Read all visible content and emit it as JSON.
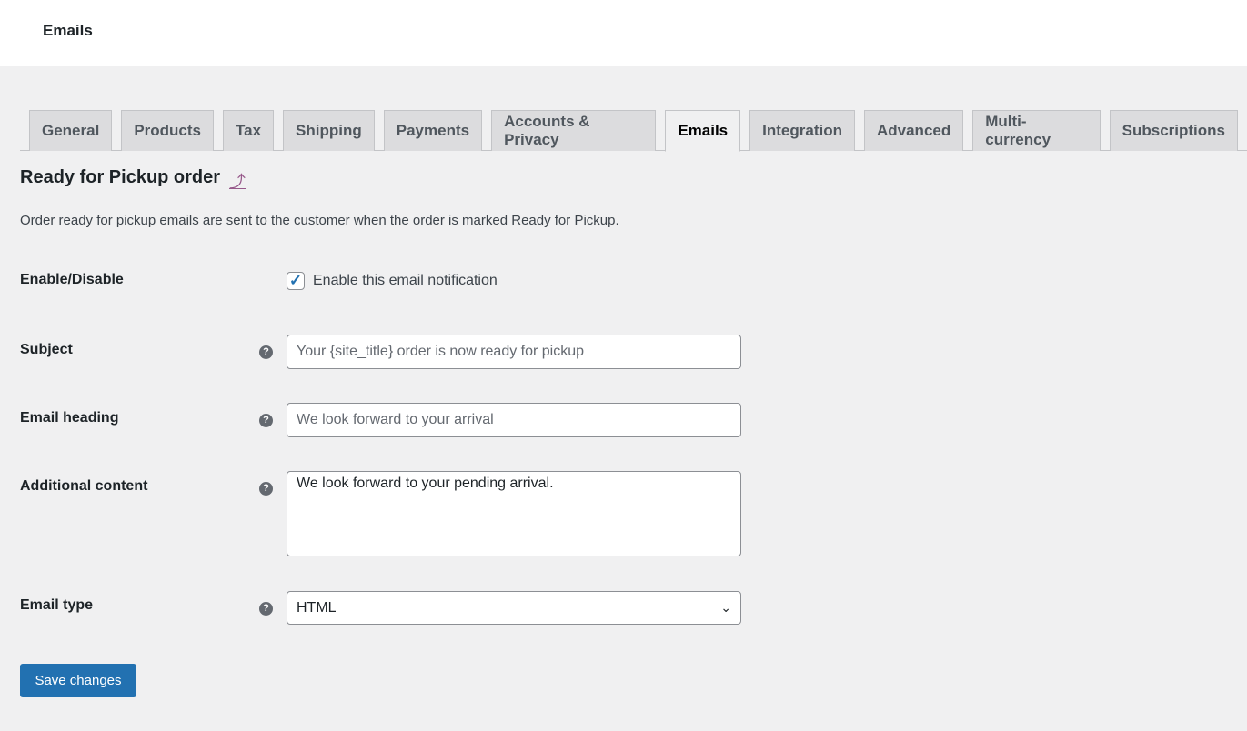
{
  "header": {
    "title": "Emails"
  },
  "tabs": [
    {
      "label": "General"
    },
    {
      "label": "Products"
    },
    {
      "label": "Tax"
    },
    {
      "label": "Shipping"
    },
    {
      "label": "Payments"
    },
    {
      "label": "Accounts & Privacy"
    },
    {
      "label": "Emails",
      "active": true
    },
    {
      "label": "Integration"
    },
    {
      "label": "Advanced"
    },
    {
      "label": "Multi-currency"
    },
    {
      "label": "Subscriptions"
    }
  ],
  "section": {
    "title": "Ready for Pickup order",
    "back_icon": "return-arrow-icon",
    "description": "Order ready for pickup emails are sent to the customer when the order is marked Ready for Pickup."
  },
  "form": {
    "enable": {
      "label": "Enable/Disable",
      "checkbox_label": "Enable this email notification",
      "checked": true
    },
    "subject": {
      "label": "Subject",
      "placeholder": "Your {site_title} order is now ready for pickup",
      "value": ""
    },
    "heading": {
      "label": "Email heading",
      "placeholder": "We look forward to your arrival",
      "value": ""
    },
    "additional": {
      "label": "Additional content",
      "value": "We look forward to your pending arrival."
    },
    "email_type": {
      "label": "Email type",
      "value": "HTML"
    },
    "help_icon": "?"
  },
  "save_label": "Save changes",
  "colors": {
    "accent": "#2271b1",
    "link": "#96588a"
  }
}
